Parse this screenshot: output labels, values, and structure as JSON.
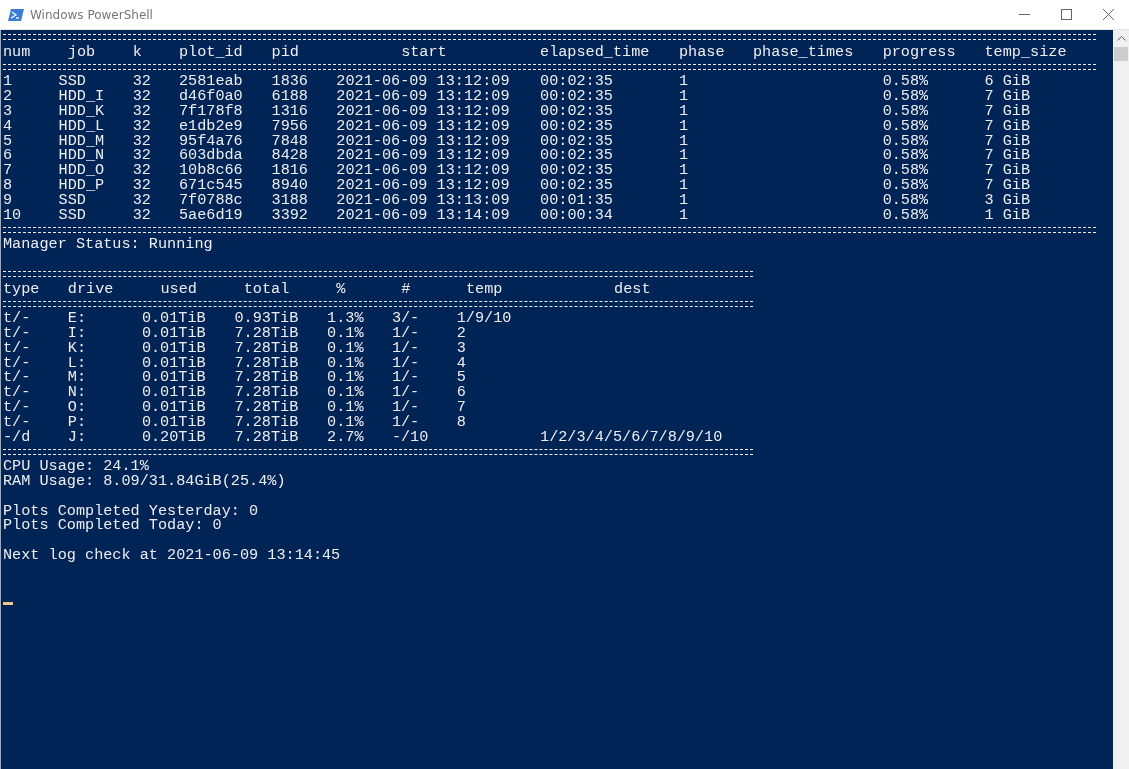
{
  "window": {
    "title": "Windows PowerShell"
  },
  "jobs": {
    "columns": [
      "num",
      "job",
      "k",
      "plot_id",
      "pid",
      "start",
      "elapsed_time",
      "phase",
      "phase_times",
      "progress",
      "temp_size"
    ],
    "rows": [
      {
        "num": "1",
        "job": "SSD",
        "k": "32",
        "plot_id": "2581eab",
        "pid": "1836",
        "start": "2021-06-09 13:12:09",
        "elapsed_time": "00:02:35",
        "phase": "1",
        "progress": "0.58%",
        "temp_size": "6 GiB"
      },
      {
        "num": "2",
        "job": "HDD_I",
        "k": "32",
        "plot_id": "d46f0a0",
        "pid": "6188",
        "start": "2021-06-09 13:12:09",
        "elapsed_time": "00:02:35",
        "phase": "1",
        "progress": "0.58%",
        "temp_size": "7 GiB"
      },
      {
        "num": "3",
        "job": "HDD_K",
        "k": "32",
        "plot_id": "7f178f8",
        "pid": "1316",
        "start": "2021-06-09 13:12:09",
        "elapsed_time": "00:02:35",
        "phase": "1",
        "progress": "0.58%",
        "temp_size": "7 GiB"
      },
      {
        "num": "4",
        "job": "HDD_L",
        "k": "32",
        "plot_id": "e1db2e9",
        "pid": "7956",
        "start": "2021-06-09 13:12:09",
        "elapsed_time": "00:02:35",
        "phase": "1",
        "progress": "0.58%",
        "temp_size": "7 GiB"
      },
      {
        "num": "5",
        "job": "HDD_M",
        "k": "32",
        "plot_id": "95f4a76",
        "pid": "7848",
        "start": "2021-06-09 13:12:09",
        "elapsed_time": "00:02:35",
        "phase": "1",
        "progress": "0.58%",
        "temp_size": "7 GiB"
      },
      {
        "num": "6",
        "job": "HDD_N",
        "k": "32",
        "plot_id": "603dbda",
        "pid": "8428",
        "start": "2021-06-09 13:12:09",
        "elapsed_time": "00:02:35",
        "phase": "1",
        "progress": "0.58%",
        "temp_size": "7 GiB"
      },
      {
        "num": "7",
        "job": "HDD_O",
        "k": "32",
        "plot_id": "10b8c66",
        "pid": "1816",
        "start": "2021-06-09 13:12:09",
        "elapsed_time": "00:02:35",
        "phase": "1",
        "progress": "0.58%",
        "temp_size": "7 GiB"
      },
      {
        "num": "8",
        "job": "HDD_P",
        "k": "32",
        "plot_id": "671c545",
        "pid": "8940",
        "start": "2021-06-09 13:12:09",
        "elapsed_time": "00:02:35",
        "phase": "1",
        "progress": "0.58%",
        "temp_size": "7 GiB"
      },
      {
        "num": "9",
        "job": "SSD",
        "k": "32",
        "plot_id": "7f0788c",
        "pid": "3188",
        "start": "2021-06-09 13:13:09",
        "elapsed_time": "00:01:35",
        "phase": "1",
        "progress": "0.58%",
        "temp_size": "3 GiB"
      },
      {
        "num": "10",
        "job": "SSD",
        "k": "32",
        "plot_id": "5ae6d19",
        "pid": "3392",
        "start": "2021-06-09 13:14:09",
        "elapsed_time": "00:00:34",
        "phase": "1",
        "progress": "0.58%",
        "temp_size": "1 GiB"
      }
    ]
  },
  "manager_status": "Manager Status: Running",
  "drives": {
    "columns": [
      "type",
      "drive",
      "used",
      "total",
      "%",
      "#",
      "temp",
      "dest"
    ],
    "rows": [
      {
        "type": "t/-",
        "drive": "E:",
        "used": "0.01TiB",
        "total": "0.93TiB",
        "percent": "1.3%",
        "count": "3/-",
        "temp": "1/9/10"
      },
      {
        "type": "t/-",
        "drive": "I:",
        "used": "0.01TiB",
        "total": "7.28TiB",
        "percent": "0.1%",
        "count": "1/-",
        "temp": "2"
      },
      {
        "type": "t/-",
        "drive": "K:",
        "used": "0.01TiB",
        "total": "7.28TiB",
        "percent": "0.1%",
        "count": "1/-",
        "temp": "3"
      },
      {
        "type": "t/-",
        "drive": "L:",
        "used": "0.01TiB",
        "total": "7.28TiB",
        "percent": "0.1%",
        "count": "1/-",
        "temp": "4"
      },
      {
        "type": "t/-",
        "drive": "M:",
        "used": "0.01TiB",
        "total": "7.28TiB",
        "percent": "0.1%",
        "count": "1/-",
        "temp": "5"
      },
      {
        "type": "t/-",
        "drive": "N:",
        "used": "0.01TiB",
        "total": "7.28TiB",
        "percent": "0.1%",
        "count": "1/-",
        "temp": "6"
      },
      {
        "type": "t/-",
        "drive": "O:",
        "used": "0.01TiB",
        "total": "7.28TiB",
        "percent": "0.1%",
        "count": "1/-",
        "temp": "7"
      },
      {
        "type": "t/-",
        "drive": "P:",
        "used": "0.01TiB",
        "total": "7.28TiB",
        "percent": "0.1%",
        "count": "1/-",
        "temp": "8"
      },
      {
        "type": "-/d",
        "drive": "J:",
        "used": "0.20TiB",
        "total": "7.28TiB",
        "percent": "2.7%",
        "count": "-/10",
        "dest": "1/2/3/4/5/6/7/8/9/10"
      }
    ]
  },
  "usage": [
    "CPU Usage: 24.1%",
    "RAM Usage: 8.09/31.84GiB(25.4%)"
  ],
  "plots": [
    "Plots Completed Yesterday: 0",
    "Plots Completed Today: 0"
  ],
  "next_check": "Next log check at 2021-06-09 13:14:45"
}
